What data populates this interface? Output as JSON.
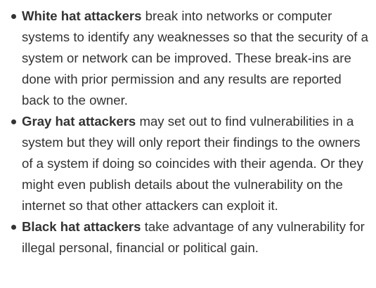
{
  "items": [
    {
      "term": "White hat attackers",
      "text": "break into networks or computer systems to identify any weaknesses so that the security of a system or network can be improved. These break-ins are done with prior permission and any results are reported back to the owner."
    },
    {
      "term": "Gray hat attackers",
      "text": "may set out to find vulnerabilities in a system but they will only report their findings to the owners of a system if doing so coincides with their agenda. Or they might even publish details about the vulnerability on the internet so that other attackers can exploit it."
    },
    {
      "term": "Black hat attackers",
      "text": "take advantage of any vulnerability for illegal personal, financial or political gain."
    }
  ]
}
